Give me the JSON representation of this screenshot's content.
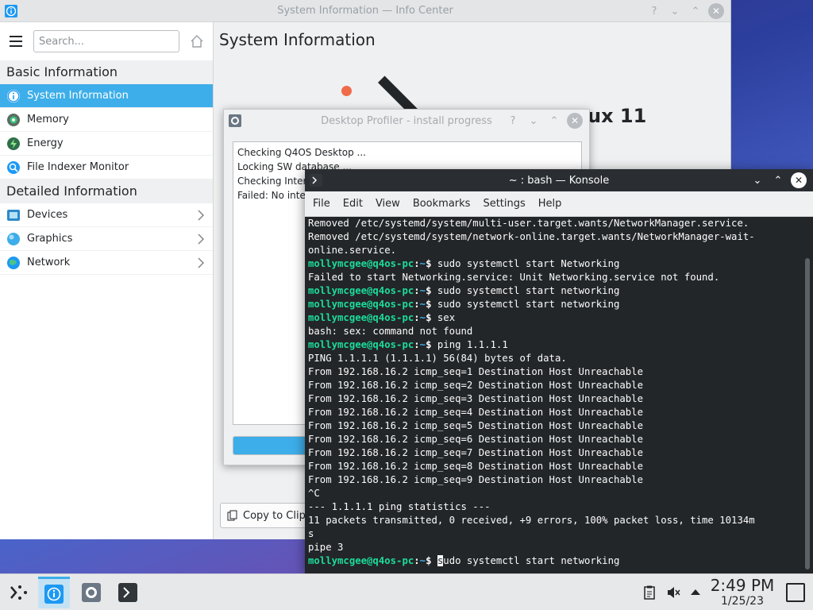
{
  "info_center": {
    "title": "System Information — Info Center",
    "search_placeholder": "Search...",
    "main_title": "System Information",
    "distro_text": "ux 11",
    "copy_button": "Copy to Clipb",
    "basic_heading": "Basic Information",
    "basic_items": [
      {
        "label": "System Information",
        "icon": "info-icon"
      },
      {
        "label": "Memory",
        "icon": "memory-icon"
      },
      {
        "label": "Energy",
        "icon": "energy-icon"
      },
      {
        "label": "File Indexer Monitor",
        "icon": "search-icon"
      }
    ],
    "detailed_heading": "Detailed Information",
    "detailed_items": [
      {
        "label": "Devices",
        "icon": "devices-icon"
      },
      {
        "label": "Graphics",
        "icon": "graphics-icon"
      },
      {
        "label": "Network",
        "icon": "network-icon"
      }
    ]
  },
  "profiler": {
    "title": "Desktop Profiler - install progress",
    "log": [
      "Checking Q4OS Desktop ...",
      "Locking SW database ...",
      "Checking Intern",
      "Failed: No intern"
    ],
    "progress_fraction": 0.32
  },
  "konsole": {
    "title": "~ : bash — Konsole",
    "menu": [
      "File",
      "Edit",
      "View",
      "Bookmarks",
      "Settings",
      "Help"
    ],
    "prompt_user": "mollymcgee@q4os-pc",
    "prompt_sep": ":",
    "prompt_path": "~",
    "prompt_sigil": "$",
    "lines": [
      {
        "text": "Removed /etc/systemd/system/multi-user.target.wants/NetworkManager.service."
      },
      {
        "text": "Removed /etc/systemd/system/network-online.target.wants/NetworkManager-wait-"
      },
      {
        "text": "online.service."
      },
      {
        "cmd": "sudo systemctl start Networking"
      },
      {
        "text": "Failed to start Networking.service: Unit Networking.service not found."
      },
      {
        "cmd": "sudo systemctl start networking"
      },
      {
        "cmd": "sudo systemctl start networking"
      },
      {
        "cmd": "sex"
      },
      {
        "text": "bash: sex: command not found"
      },
      {
        "cmd": "ping 1.1.1.1"
      },
      {
        "text": "PING 1.1.1.1 (1.1.1.1) 56(84) bytes of data."
      },
      {
        "text": "From 192.168.16.2 icmp_seq=1 Destination Host Unreachable"
      },
      {
        "text": "From 192.168.16.2 icmp_seq=2 Destination Host Unreachable"
      },
      {
        "text": "From 192.168.16.2 icmp_seq=3 Destination Host Unreachable"
      },
      {
        "text": "From 192.168.16.2 icmp_seq=4 Destination Host Unreachable"
      },
      {
        "text": "From 192.168.16.2 icmp_seq=5 Destination Host Unreachable"
      },
      {
        "text": "From 192.168.16.2 icmp_seq=6 Destination Host Unreachable"
      },
      {
        "text": "From 192.168.16.2 icmp_seq=7 Destination Host Unreachable"
      },
      {
        "text": "From 192.168.16.2 icmp_seq=8 Destination Host Unreachable"
      },
      {
        "text": "From 192.168.16.2 icmp_seq=9 Destination Host Unreachable"
      },
      {
        "text": "^C"
      },
      {
        "text": "--- 1.1.1.1 ping statistics ---"
      },
      {
        "text": "11 packets transmitted, 0 received, +9 errors, 100% packet loss, time 10134m"
      },
      {
        "text": "s"
      },
      {
        "text": "pipe 3"
      },
      {
        "cmd": "sudo systemctl start networking",
        "cursor": true
      }
    ]
  },
  "taskbar": {
    "tasks": [
      "info-center-task",
      "desktop-profiler-task",
      "konsole-task"
    ],
    "active_task": "info-center-task",
    "time": "2:49 PM",
    "date": "1/25/23"
  },
  "colors": {
    "accent": "#3daee9",
    "prompt_user": "#1cdc9a",
    "terminal_bg": "#232629"
  }
}
